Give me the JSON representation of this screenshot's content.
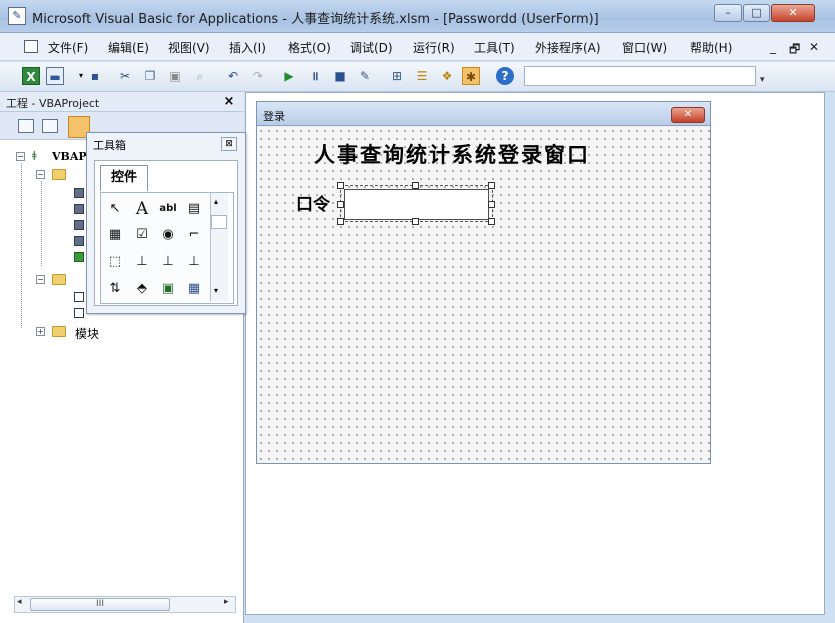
{
  "window": {
    "title": "Microsoft Visual Basic for Applications - 人事查询统计系统.xlsm - [Passwordd (UserForm)]",
    "app_icon_glyph": "✎",
    "caption_buttons": {
      "minimize": "–",
      "maximize": "□",
      "close": "✕"
    }
  },
  "menu": {
    "items": [
      "文件(F)",
      "编辑(E)",
      "视图(V)",
      "插入(I)",
      "格式(O)",
      "调试(D)",
      "运行(R)",
      "工具(T)",
      "外接程序(A)",
      "窗口(W)",
      "帮助(H)"
    ],
    "mdi": {
      "minimize": "_",
      "restore": "🗗",
      "close": "✕"
    }
  },
  "toolbar": {
    "icons": [
      "excel-icon",
      "insert-userform-icon",
      "save-icon",
      "cut-icon",
      "copy-icon",
      "paste-icon",
      "find-icon",
      "undo-icon",
      "redo-icon",
      "run-icon",
      "break-icon",
      "reset-icon",
      "design-mode-icon",
      "project-explorer-icon",
      "properties-icon",
      "object-browser-icon",
      "toolbox-icon",
      "help-icon"
    ],
    "combo_value": ""
  },
  "project": {
    "title": "工程 - VBAProject",
    "root_label": "VBAP",
    "modules_label": "模块",
    "hscroll_thumb_glyph": "III"
  },
  "toolbox": {
    "title": "工具箱",
    "tab_label": "控件",
    "close_glyph": "⊠",
    "tools": [
      "↖",
      "A",
      "abl",
      "▤",
      "▦",
      "☑",
      "◉",
      "⌐",
      "⬚",
      "⊥",
      "⊥",
      "⊥",
      "⇅",
      "⬘",
      "▣",
      "▦"
    ]
  },
  "userform": {
    "title": "登录",
    "heading": "人事查询统计系统登录窗口",
    "password_label": "口令",
    "password_value": ""
  },
  "colors": {
    "frame": "#cfe0f3",
    "close_red": "#c7432c",
    "toolbox_active": "#f4c26a"
  }
}
